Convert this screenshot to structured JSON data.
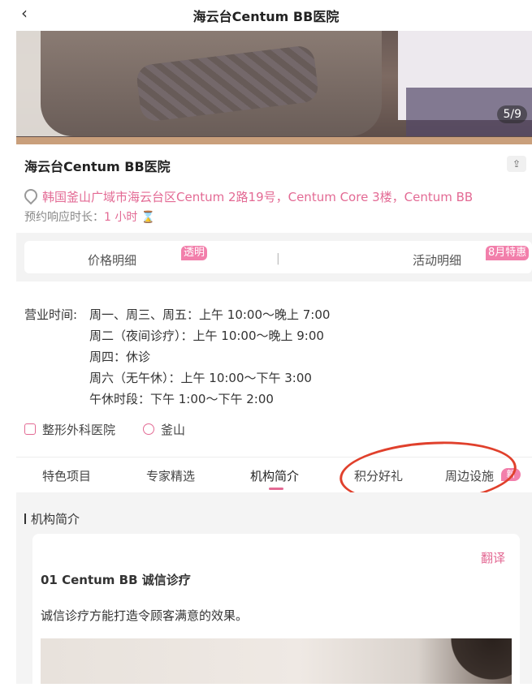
{
  "header": {
    "back_icon": "‹",
    "title": "海云台Centum BB医院"
  },
  "hero": {
    "counter": "5/9"
  },
  "hospital": {
    "name": "海云台Centum BB医院",
    "share_icon": "⇪",
    "address": "韩国釜山广域市海云台区Centum 2路19号，Centum Core 3楼，Centum BB",
    "response_label": "预约响应时长：",
    "response_value": "1 小时",
    "response_icon": "⌛"
  },
  "price_bar": {
    "left_label": "价格明细",
    "left_tag": "透明",
    "divider": "|",
    "right_label": "活动明细",
    "right_tag": "8月特惠"
  },
  "hours": {
    "label": "营业时间:",
    "lines": [
      "周一、周三、周五：上午 10:00～晚上 7:00",
      "周二（夜间诊疗）：上午 10:00～晚上 9:00",
      "周四：休诊",
      "周六（无午休）：上午 10:00～下午 3:00",
      "午休时段：下午 1:00～下午 2:00"
    ]
  },
  "categories": {
    "type": "整形外科医院",
    "location": "釜山"
  },
  "tabs": {
    "items": [
      "特色项目",
      "专家精选",
      "机构简介",
      "积分好礼",
      "周边设施"
    ],
    "active": "机构简介",
    "new_badge": "新"
  },
  "intro": {
    "section_title": "机构简介",
    "translate": "翻译",
    "heading": "01 Centum BB 诚信诊疗",
    "paragraph": "诚信诊疗方能打造令顾客满意的效果。"
  },
  "colors": {
    "accent": "#e36a94",
    "annotation_circle": "#e0402c"
  }
}
